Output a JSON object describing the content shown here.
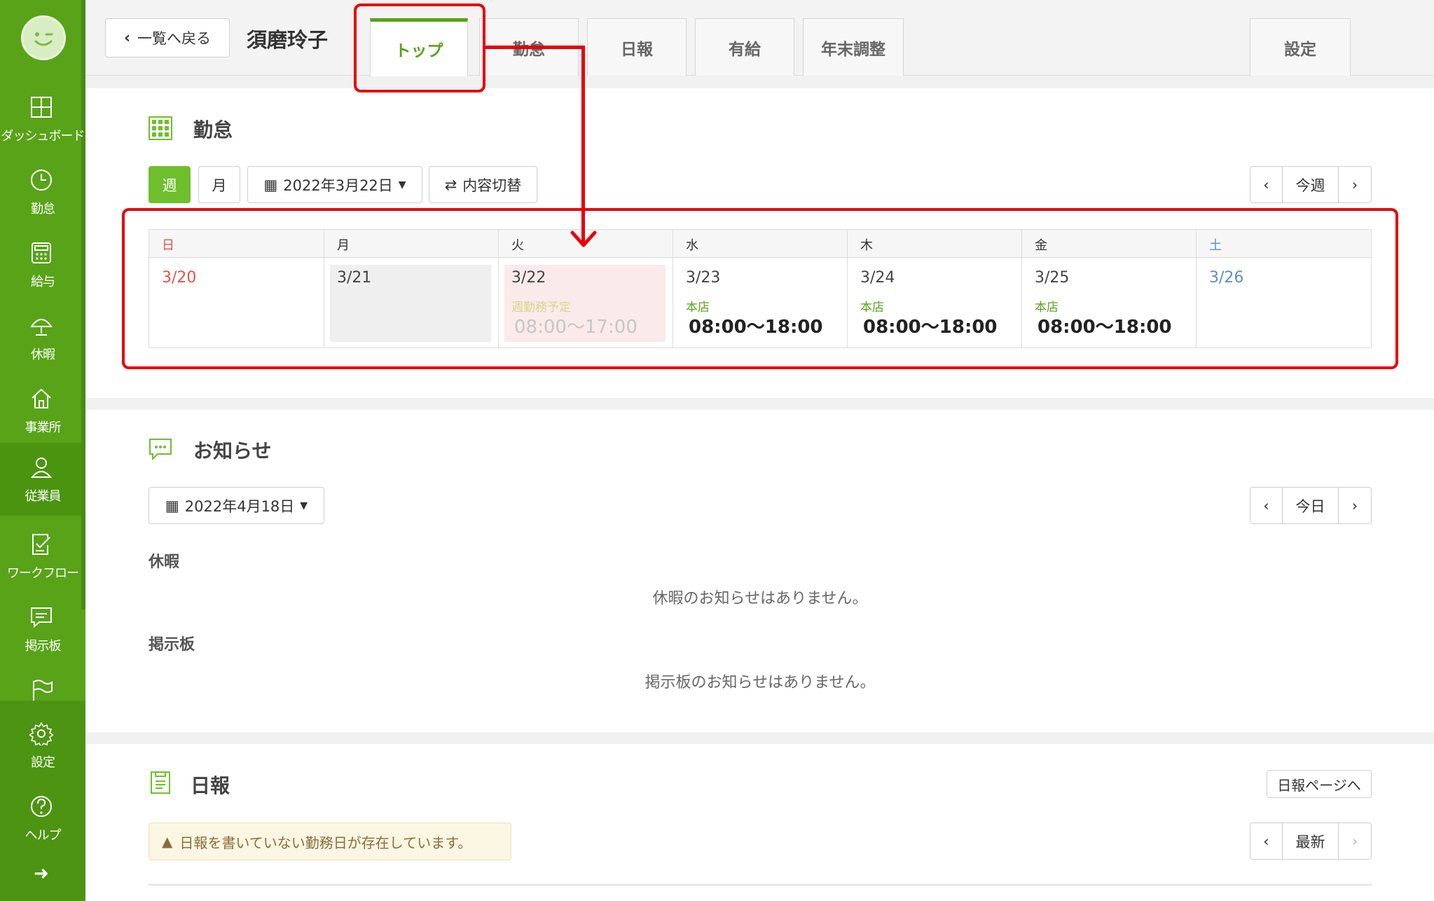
{
  "sidebar": {
    "items": [
      {
        "label": "ダッシュボード",
        "icon": "dashboard-icon"
      },
      {
        "label": "勤怠",
        "icon": "clock-icon"
      },
      {
        "label": "給与",
        "icon": "calculator-icon"
      },
      {
        "label": "休暇",
        "icon": "umbrella-icon"
      },
      {
        "label": "事業所",
        "icon": "home-icon"
      },
      {
        "label": "従業員",
        "icon": "user-icon"
      },
      {
        "label": "ワークフロー",
        "icon": "checklist-icon"
      },
      {
        "label": "掲示板",
        "icon": "message-icon"
      },
      {
        "label": "",
        "icon": "flag-icon"
      },
      {
        "label": "設定",
        "icon": "gear-icon"
      },
      {
        "label": "ヘルプ",
        "icon": "help-icon"
      }
    ],
    "expand_icon": "arrow-right-icon"
  },
  "header": {
    "back_label": "一覧へ戻る",
    "employee_name": "須磨玲子",
    "tabs": [
      {
        "label": "トップ",
        "active": true
      },
      {
        "label": "勤怠",
        "active": false
      },
      {
        "label": "日報",
        "active": false
      },
      {
        "label": "有給",
        "active": false
      },
      {
        "label": "年末調整",
        "active": false
      },
      {
        "label": "設定",
        "active": false
      }
    ]
  },
  "attendance": {
    "title": "勤怠",
    "view_week": "週",
    "view_month": "月",
    "date_picker": "2022年3月22日",
    "toggle_label": "内容切替",
    "nav_current": "今週",
    "days": [
      {
        "name": "日",
        "date": "3/20",
        "shop": "",
        "time": "",
        "type": "sunday"
      },
      {
        "name": "月",
        "date": "3/21",
        "shop": "",
        "time": "",
        "type": "past"
      },
      {
        "name": "火",
        "date": "3/22",
        "shop": "週勤務予定",
        "time": "08:00～17:00",
        "type": "today"
      },
      {
        "name": "水",
        "date": "3/23",
        "shop": "本店",
        "time": "08:00～18:00",
        "type": "normal"
      },
      {
        "name": "木",
        "date": "3/24",
        "shop": "本店",
        "time": "08:00～18:00",
        "type": "normal"
      },
      {
        "name": "金",
        "date": "3/25",
        "shop": "本店",
        "time": "08:00～18:00",
        "type": "normal"
      },
      {
        "name": "土",
        "date": "3/26",
        "shop": "",
        "time": "",
        "type": "saturday"
      }
    ]
  },
  "notices": {
    "title": "お知らせ",
    "date_picker": "2022年4月18日",
    "nav_current": "今日",
    "leave_label": "休暇",
    "leave_empty": "休暇のお知らせはありません。",
    "board_label": "掲示板",
    "board_empty": "掲示板のお知らせはありません。"
  },
  "daily_report": {
    "title": "日報",
    "page_button": "日報ページへ",
    "alert": "日報を書いていない勤務日が存在しています。",
    "nav_current": "最新"
  },
  "colors": {
    "brand": "#58a318",
    "annotation": "#e8000b"
  }
}
